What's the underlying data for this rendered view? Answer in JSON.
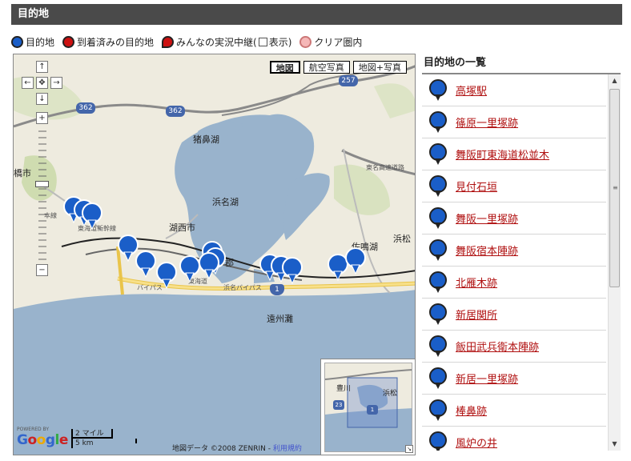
{
  "header": {
    "title": "目的地"
  },
  "legend": {
    "destination": "目的地",
    "arrived": "到着済みの目的地",
    "relay": "みんなの実況中継(",
    "relay_show": "表示)",
    "clear": "クリア圏内"
  },
  "map": {
    "types": [
      "地図",
      "航空写真",
      "地図+写真"
    ],
    "active_type": "地図",
    "labels": {
      "lake_main": "浜名湖",
      "lake_north": "猪鼻湖",
      "city_kosai": "湖西市",
      "sea": "遠州灘",
      "city_left": "橋市",
      "city_sanagi": "佐鳴湖",
      "city_hamamatsu": "浜松",
      "town_gun": "郡",
      "route_362a": "362",
      "route_362b": "362",
      "route_257": "257",
      "route_1": "1",
      "highway": "東名高速道路",
      "bypass": "浜名バイパス",
      "bypass2": "バイパス",
      "tokaido": "東海道",
      "shinkansen": "東海道新幹線",
      "line": "本線",
      "ov_city": "豊川",
      "ov_hama": "浜松",
      "ov_23": "23",
      "ov_1": "1"
    },
    "scale_top": "2 マイル",
    "scale_bottom": "5 km",
    "powered": "POWERED BY",
    "logo": "Google",
    "copyright": "地図データ ©2008 ZENRIN - ",
    "terms": "利用規約"
  },
  "panel": {
    "title": "目的地の一覧",
    "items": [
      "高塚駅",
      "篠原一里塚跡",
      "舞阪町東海道松並木",
      "見付石垣",
      "舞阪一里塚跡",
      "舞阪宿本陣跡",
      "北雁木跡",
      "新居関所",
      "飯田武兵衛本陣跡",
      "新居一里塚跡",
      "棒鼻跡",
      "風炉の井"
    ]
  },
  "colors": {
    "header_bg": "#4a4a4a",
    "marker_blue": "#1a5ec8",
    "link_red": "#b01010",
    "water": "#99b3cc",
    "land": "#eeebdf"
  }
}
